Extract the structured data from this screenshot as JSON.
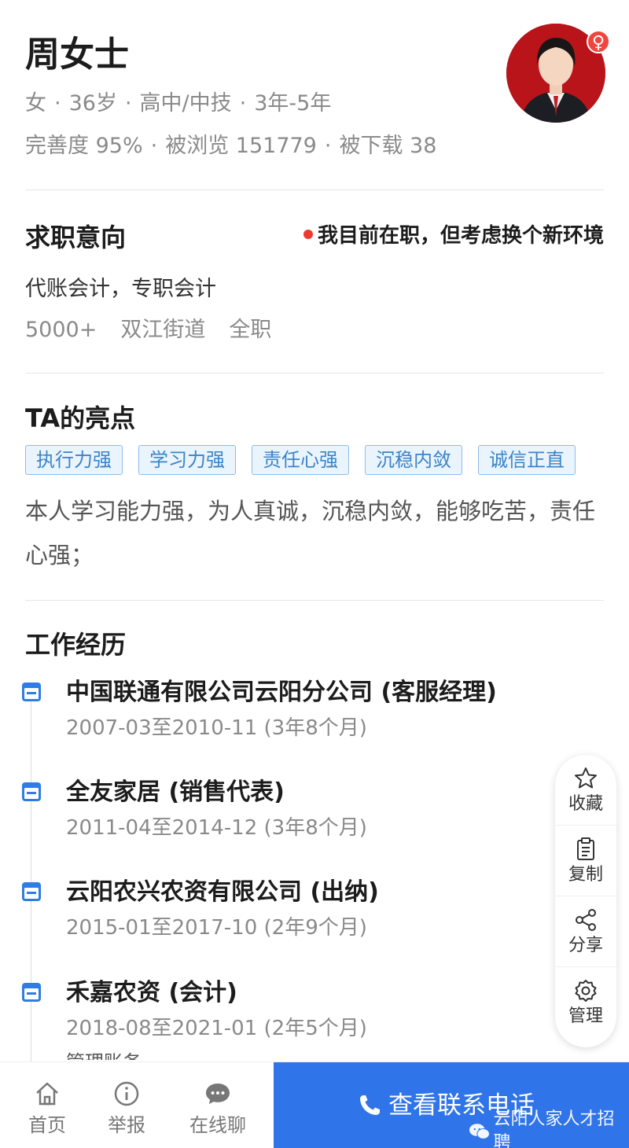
{
  "profile": {
    "name": "周女士",
    "gender": "女",
    "age": "36岁",
    "education": "高中/中技",
    "experience": "3年-5年",
    "completeness": "完善度 95%",
    "views": "被浏览 151779",
    "downloads": "被下载 38",
    "separator": "·",
    "gender_symbol": "♀"
  },
  "intent": {
    "title": "求职意向",
    "status": "我目前在职，但考虑换个新环境",
    "positions": "代账会计，专职会计",
    "salary": "5000+",
    "location": "双江街道",
    "type": "全职"
  },
  "highlights": {
    "title": "TA的亮点",
    "tags": [
      "执行力强",
      "学习力强",
      "责任心强",
      "沉稳内敛",
      "诚信正直"
    ],
    "description": "本人学习能力强，为人真诚，沉稳内敛，能够吃苦，责任心强；"
  },
  "work": {
    "title": "工作经历",
    "items": [
      {
        "title": "中国联通有限公司云阳分公司 (客服经理)",
        "date": "2007-03至2010-11 (3年8个月)"
      },
      {
        "title": "全友家居 (销售代表)",
        "date": "2011-04至2014-12 (3年8个月)"
      },
      {
        "title": "云阳农兴农资有限公司 (出纳)",
        "date": "2015-01至2017-10 (2年9个月)"
      },
      {
        "title": "禾嘉农资 (会计)",
        "date": "2018-08至2021-01 (2年5个月)",
        "note": "管理账务"
      }
    ]
  },
  "float_actions": {
    "favorite": "收藏",
    "copy": "复制",
    "share": "分享",
    "manage": "管理"
  },
  "bottom_nav": {
    "home": "首页",
    "report": "举报",
    "chat": "在线聊",
    "cta": "查看联系电话",
    "watermark": "云阳人家人才招聘"
  },
  "colors": {
    "accent": "#2f74e8",
    "tag_border": "#8cbde8",
    "tag_bg": "#eaf4fd",
    "status_dot": "#f0392f"
  }
}
